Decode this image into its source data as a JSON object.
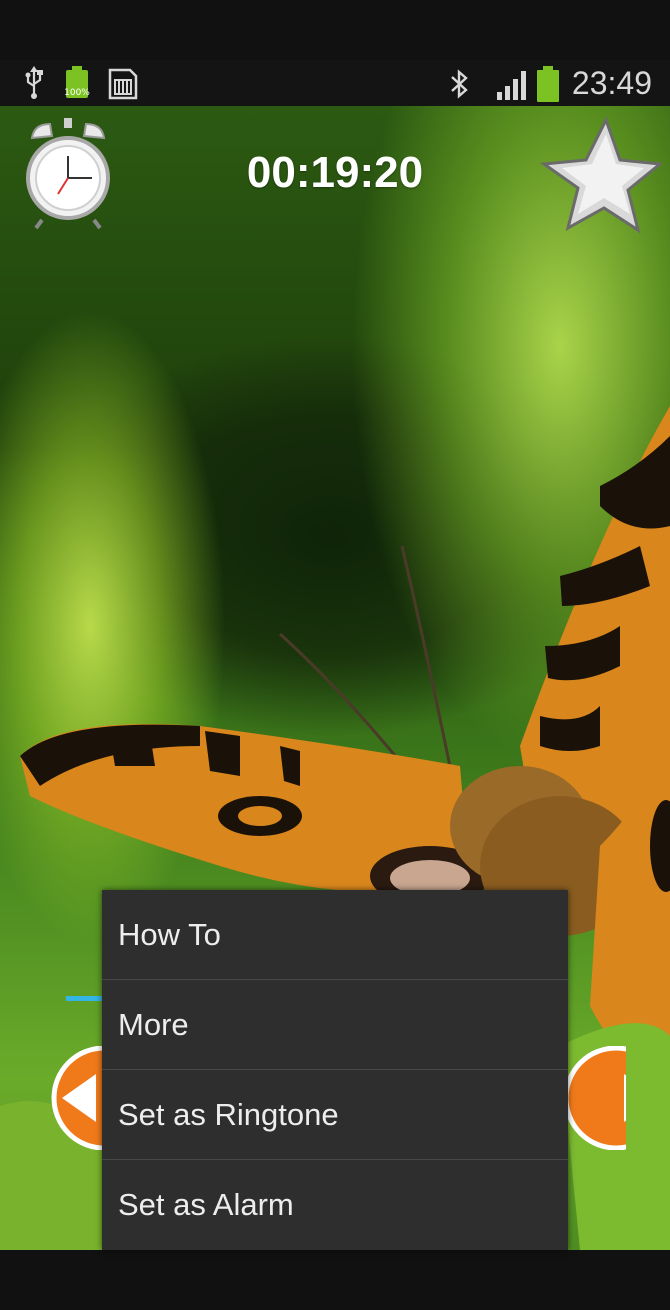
{
  "status_bar": {
    "icons": [
      "usb-icon",
      "battery-full-icon",
      "sd-card-icon",
      "bluetooth-icon",
      "signal-icon",
      "battery-icon"
    ],
    "battery_small_text": "100%",
    "time": "23:49",
    "colors": {
      "battery": "#7cc223",
      "text": "#d8d8d8"
    }
  },
  "timer": {
    "value": "00:19:20"
  },
  "top_bar": {
    "left_icon": "alarm-clock-icon",
    "right_icon": "star-icon"
  },
  "navigation": {
    "left_icon": "arrow-left-icon",
    "right_icon": "arrow-right-icon",
    "accent": "#33b5e5"
  },
  "menu": {
    "items": [
      {
        "label": "How To"
      },
      {
        "label": "More"
      },
      {
        "label": "Set as Ringtone"
      },
      {
        "label": "Set as Alarm"
      }
    ]
  }
}
